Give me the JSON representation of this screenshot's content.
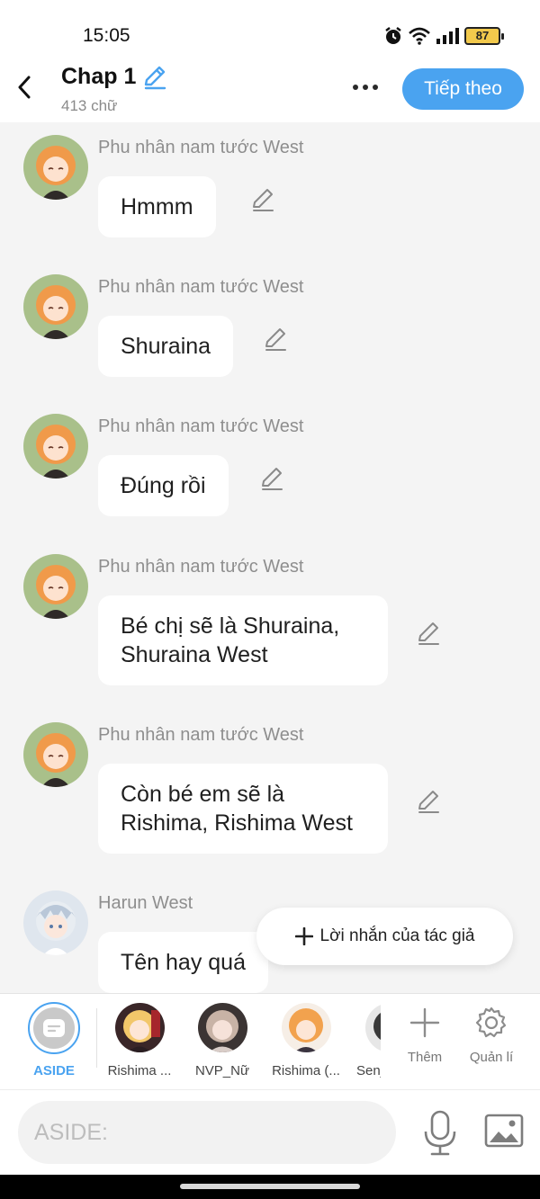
{
  "status": {
    "time": "15:05",
    "battery": "87"
  },
  "header": {
    "title": "Chap 1",
    "word_count": "413 chữ",
    "next_label": "Tiếp theo"
  },
  "messages": [
    {
      "name": "Phu nhân nam tước West",
      "text": "Hmmm"
    },
    {
      "name": "Phu nhân nam tước West",
      "text": "Shuraina"
    },
    {
      "name": "Phu nhân nam tước West",
      "text": "Đúng rồi"
    },
    {
      "name": "Phu nhân nam tước West",
      "text": "Bé chị sẽ là Shuraina, Shuraina West"
    },
    {
      "name": "Phu nhân nam tước West",
      "text": "Còn bé em sẽ là Rishima, Rishima West"
    },
    {
      "name": "Harun West",
      "text": "Tên hay quá"
    }
  ],
  "author_note": {
    "label": "Lời nhắn của tác giả"
  },
  "characters": [
    {
      "label": "ASIDE"
    },
    {
      "label": "Rishima ..."
    },
    {
      "label": "NVP_Nữ"
    },
    {
      "label": "Rishima (..."
    },
    {
      "label": "Senj"
    }
  ],
  "tools": {
    "add_label": "Thêm",
    "manage_label": "Quản lí"
  },
  "input": {
    "placeholder": "ASIDE:"
  },
  "colors": {
    "accent": "#4aa3f0",
    "bubble": "#ffffff",
    "background": "#f4f4f4"
  }
}
